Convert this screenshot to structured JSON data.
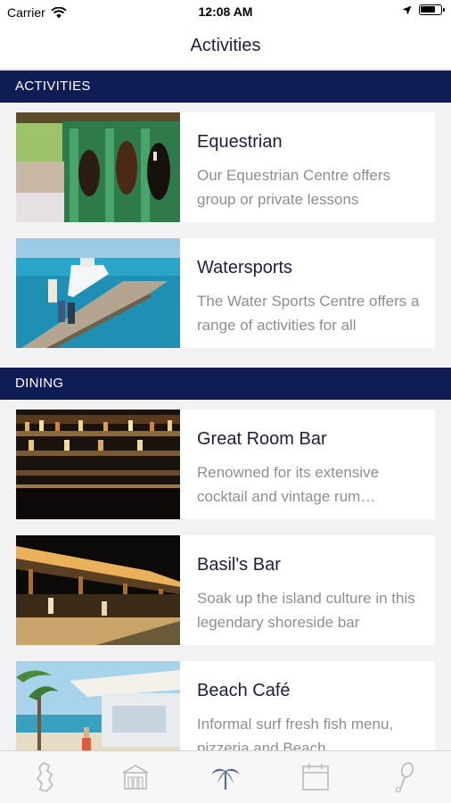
{
  "status": {
    "carrier": "Carrier",
    "time": "12:08 AM",
    "battery_level": 0.75
  },
  "nav": {
    "title": "Activities"
  },
  "sections": [
    {
      "header": "ACTIVITIES",
      "items": [
        {
          "title": "Equestrian",
          "description": "Our Equestrian Centre offers group or private lessons"
        },
        {
          "title": "Watersports",
          "description": "The Water Sports Centre offers a range of activities for all"
        }
      ]
    },
    {
      "header": "DINING",
      "items": [
        {
          "title": "Great Room Bar",
          "description": "Renowned for its extensive cocktail and vintage rum selection"
        },
        {
          "title": "Basil's Bar",
          "description": "Soak up the island culture in this legendary shoreside bar"
        },
        {
          "title": "Beach Café",
          "description": "Informal surf fresh fish menu, pizzeria and Beach"
        }
      ]
    }
  ],
  "tabs": [
    {
      "icon": "island-map-icon",
      "active": false
    },
    {
      "icon": "building-icon",
      "active": false
    },
    {
      "icon": "palm-tree-icon",
      "active": true
    },
    {
      "icon": "calendar-icon",
      "active": false
    },
    {
      "icon": "tennis-racket-icon",
      "active": false
    }
  ],
  "colors": {
    "header_bg": "#101c54",
    "title_text": "#1a1f3d",
    "desc_text": "#8e8e93",
    "tab_inactive": "#b9b9bf",
    "tab_active": "#5a6b8e"
  }
}
